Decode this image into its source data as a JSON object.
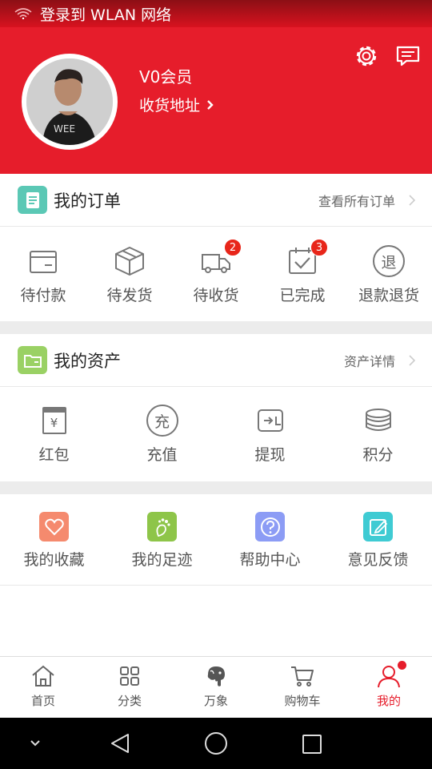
{
  "status_bar": {
    "text": "登录到 WLAN 网络"
  },
  "header": {
    "member_level": "V0会员",
    "address_label": "收货地址",
    "icons": [
      "gear-icon",
      "message-icon"
    ],
    "background_color": "#e61d2b"
  },
  "orders": {
    "title": "我的订单",
    "link": "查看所有订单",
    "items": [
      {
        "label": "待付款",
        "icon": "wallet-icon",
        "badge": ""
      },
      {
        "label": "待发货",
        "icon": "box-icon",
        "badge": ""
      },
      {
        "label": "待收货",
        "icon": "truck-icon",
        "badge": "2"
      },
      {
        "label": "已完成",
        "icon": "check-calendar-icon",
        "badge": "3"
      },
      {
        "label": "退款退货",
        "icon": "refund-icon",
        "badge": ""
      }
    ],
    "refund_glyph": "退"
  },
  "assets": {
    "title": "我的资产",
    "link": "资产详情",
    "items": [
      {
        "label": "红包",
        "icon": "red-packet-icon"
      },
      {
        "label": "充值",
        "icon": "recharge-icon"
      },
      {
        "label": "提现",
        "icon": "withdraw-icon"
      },
      {
        "label": "积分",
        "icon": "coins-icon"
      }
    ],
    "yen_glyph": "¥",
    "recharge_glyph": "充"
  },
  "services": {
    "items": [
      {
        "label": "我的收藏",
        "icon": "heart-icon",
        "color": "#f58a6e"
      },
      {
        "label": "我的足迹",
        "icon": "footprint-icon",
        "color": "#8ec549"
      },
      {
        "label": "帮助中心",
        "icon": "help-icon",
        "color": "#8c9cf5"
      },
      {
        "label": "意见反馈",
        "icon": "feedback-icon",
        "color": "#3fcbd3"
      }
    ]
  },
  "tabbar": {
    "items": [
      {
        "label": "首页",
        "icon": "home-icon",
        "active": false
      },
      {
        "label": "分类",
        "icon": "grid-icon",
        "active": false
      },
      {
        "label": "万象",
        "icon": "elephant-icon",
        "active": false
      },
      {
        "label": "购物车",
        "icon": "cart-icon",
        "active": false
      },
      {
        "label": "我的",
        "icon": "user-icon",
        "active": true
      }
    ]
  }
}
